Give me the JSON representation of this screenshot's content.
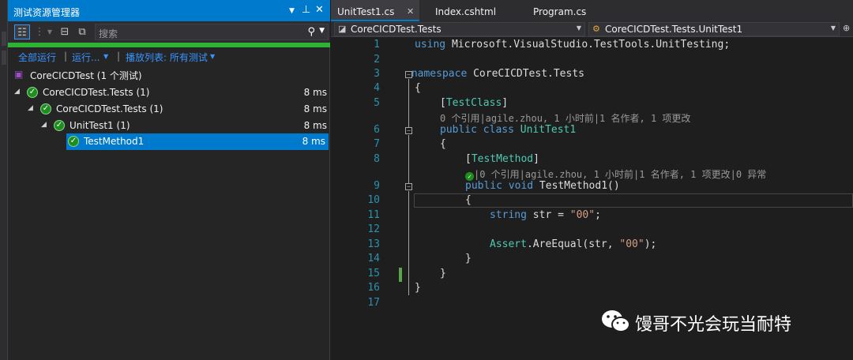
{
  "test_explorer": {
    "title": "测试资源管理器",
    "search_placeholder": "搜索",
    "progress": 1.0,
    "actions": {
      "run_all": "全部运行",
      "run": "运行...",
      "playlist": "播放列表: 所有测试"
    },
    "group": "CoreCICDTest (1 个测试)",
    "tree": [
      {
        "label": "CoreCICDTest.Tests (1)",
        "time": "8 ms"
      },
      {
        "label": "CoreCICDTest.Tests (1)",
        "time": "8 ms"
      },
      {
        "label": "UnitTest1 (1)",
        "time": "8 ms"
      },
      {
        "label": "TestMethod1",
        "time": "8 ms"
      }
    ]
  },
  "editor": {
    "tabs": [
      "UnitTest1.cs",
      "Index.cshtml",
      "Program.cs"
    ],
    "nav_left": "CoreCICDTest.Tests",
    "nav_right": "CoreCICDTest.Tests.UnitTest1",
    "line_numbers": [
      "1",
      "2",
      "3",
      "4",
      "5",
      "6",
      "7",
      "8",
      "9",
      "10",
      "11",
      "12",
      "13",
      "14",
      "15",
      "16",
      "17"
    ],
    "code": {
      "using": "using",
      "using_ns": " Microsoft.VisualStudio.TestTools.UnitTesting;",
      "namespace": "namespace",
      "namespace_name": " CoreCICDTest.Tests",
      "open_brace": "{",
      "close_brace": "}",
      "test_class_attr_open": "[",
      "test_class_attr": "TestClass",
      "test_class_attr_close": "]",
      "lens_class": "0 个引用|agile.zhou, 1 小时前|1 名作者, 1 项更改",
      "public": "public",
      "class": "class",
      "class_name": "UnitTest1",
      "test_method_attr": "TestMethod",
      "lens_method": "|0 个引用|agile.zhou, 1 小时前|1 名作者, 1 项更改|0 异常",
      "void": "void",
      "method_sig": " TestMethod1()",
      "string": "string",
      "var_decl": " str = ",
      "str_literal": "\"00\"",
      "semicolon": ";",
      "assert_cls": "Assert",
      "assert_call": ".AreEqual(str, ",
      "assert_end": ");"
    }
  },
  "watermark": "馒哥不光会玩当耐特",
  "colors": {
    "accent": "#007acc",
    "pass": "#1e8f1e",
    "keyword": "#569cd6",
    "type": "#4ec9b0",
    "string": "#d69d85",
    "line_number": "#2b91af"
  }
}
